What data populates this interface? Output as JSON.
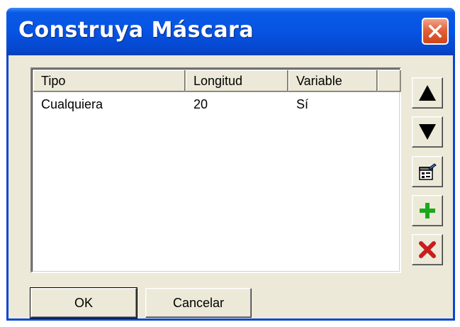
{
  "window": {
    "title": "Construya Máscara"
  },
  "table": {
    "columns": [
      "Tipo",
      "Longitud",
      "Variable"
    ],
    "rows": [
      {
        "tipo": "Cualquiera",
        "longitud": "20",
        "variable": "Sí"
      }
    ]
  },
  "side_buttons": [
    {
      "icon": "arrow-up-icon"
    },
    {
      "icon": "arrow-down-icon"
    },
    {
      "icon": "properties-icon"
    },
    {
      "icon": "add-icon"
    },
    {
      "icon": "delete-icon"
    }
  ],
  "buttons": {
    "ok_label": "OK",
    "cancel_label": "Cancelar"
  },
  "colors": {
    "titlebar": "#0753e3",
    "close": "#e2623a",
    "add": "#1ca81c",
    "delete": "#c81e1e",
    "dialog_bg": "#ece9d8"
  }
}
